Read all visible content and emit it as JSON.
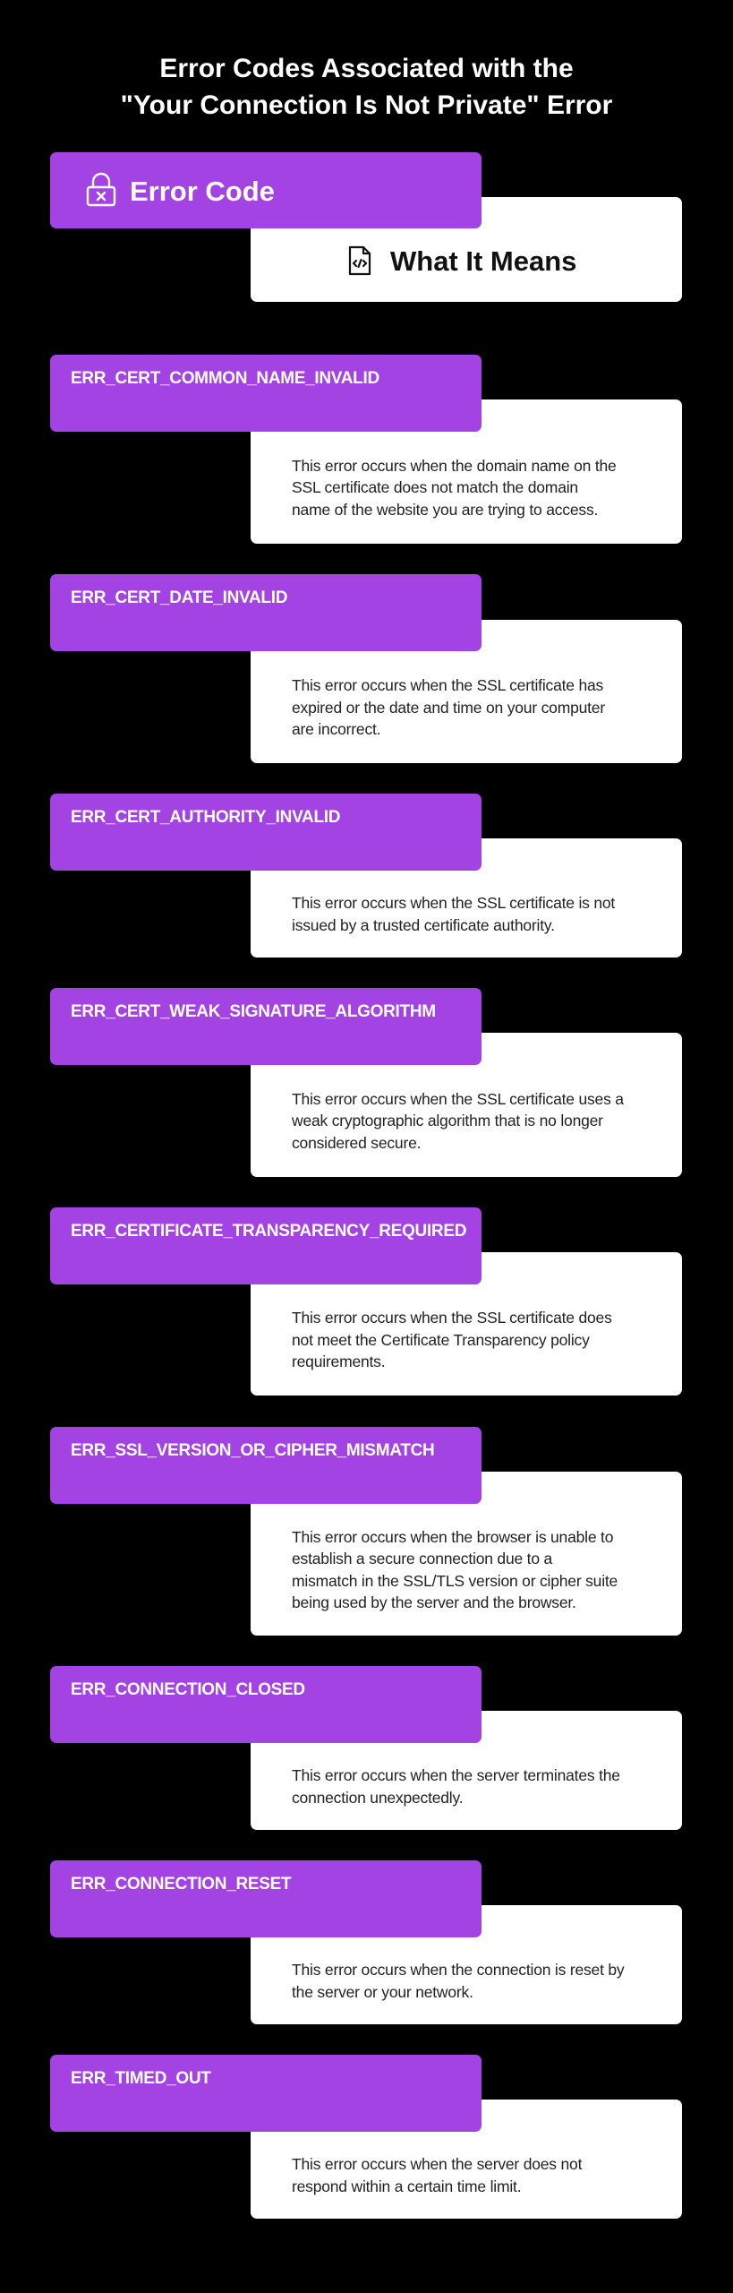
{
  "title": {
    "line1": "Error Codes Associated with the",
    "line2": "\"Your Connection Is Not Private\" Error"
  },
  "header": {
    "error_code_label": "Error Code",
    "error_code_icon": "lock-x-icon",
    "meaning_label": "What It Means",
    "meaning_icon": "code-file-icon"
  },
  "colors": {
    "background": "#000000",
    "accent": "#a443e3",
    "card": "#ffffff"
  },
  "errors": [
    {
      "code": "ERR_CERT_COMMON_NAME_INVALID",
      "lines": [
        "This error occurs when the domain name on the",
        "SSL certificate does not match the domain",
        "name of the website you are trying to access."
      ]
    },
    {
      "code": "ERR_CERT_DATE_INVALID",
      "lines": [
        "This error occurs when the SSL certificate has",
        "expired or the date and time on your computer",
        "are incorrect."
      ]
    },
    {
      "code": "ERR_CERT_AUTHORITY_INVALID",
      "lines": [
        "This error occurs when the SSL certificate is not",
        "issued by a trusted certificate authority."
      ]
    },
    {
      "code": "ERR_CERT_WEAK_SIGNATURE_ALGORITHM",
      "lines": [
        "This error occurs when the SSL certificate uses a",
        "weak cryptographic algorithm that is no longer",
        "considered secure."
      ]
    },
    {
      "code": "ERR_CERTIFICATE_TRANSPARENCY_REQUIRED",
      "lines": [
        "This error occurs when the SSL certificate does",
        "not meet the Certificate Transparency policy",
        "requirements."
      ]
    },
    {
      "code": "ERR_SSL_VERSION_OR_CIPHER_MISMATCH",
      "lines": [
        "This error occurs when the browser is unable to",
        "establish a secure connection due to a",
        "mismatch in the SSL/TLS version or cipher suite",
        "being used by the server and the browser."
      ]
    },
    {
      "code": "ERR_CONNECTION_CLOSED",
      "lines": [
        "This error occurs when the server terminates the",
        "connection unexpectedly."
      ]
    },
    {
      "code": "ERR_CONNECTION_RESET",
      "lines": [
        "This error occurs when the connection is reset by",
        "the server or your network."
      ]
    },
    {
      "code": "ERR_TIMED_OUT",
      "lines": [
        "This error occurs when the server does not",
        "respond within a certain time limit."
      ]
    }
  ]
}
